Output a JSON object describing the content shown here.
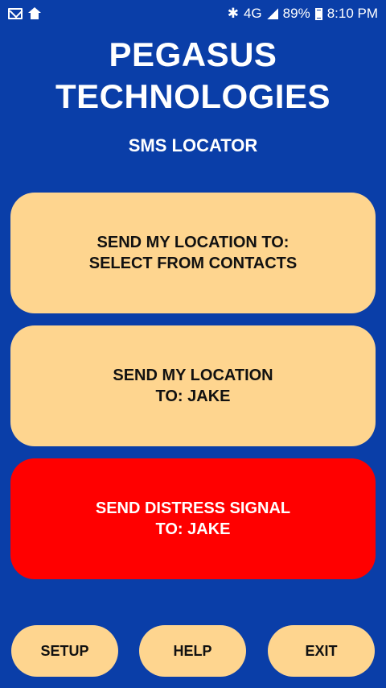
{
  "status_bar": {
    "network": "4G",
    "battery_percent": "89%",
    "time": "8:10 PM"
  },
  "header": {
    "title_line1": "PEGASUS",
    "title_line2": "TECHNOLOGIES",
    "subtitle": "SMS LOCATOR"
  },
  "actions": {
    "contacts_line1": "SEND MY LOCATION TO:",
    "contacts_line2": "SELECT FROM CONTACTS",
    "jake_line1": "SEND MY LOCATION",
    "jake_line2": "TO: JAKE",
    "distress_line1": "SEND DISTRESS SIGNAL",
    "distress_line2": "TO: JAKE"
  },
  "footer": {
    "setup": "SETUP",
    "help": "HELP",
    "exit": "EXIT"
  },
  "colors": {
    "background": "#0a3ea8",
    "button": "#fed58f",
    "distress": "#ff0000"
  }
}
